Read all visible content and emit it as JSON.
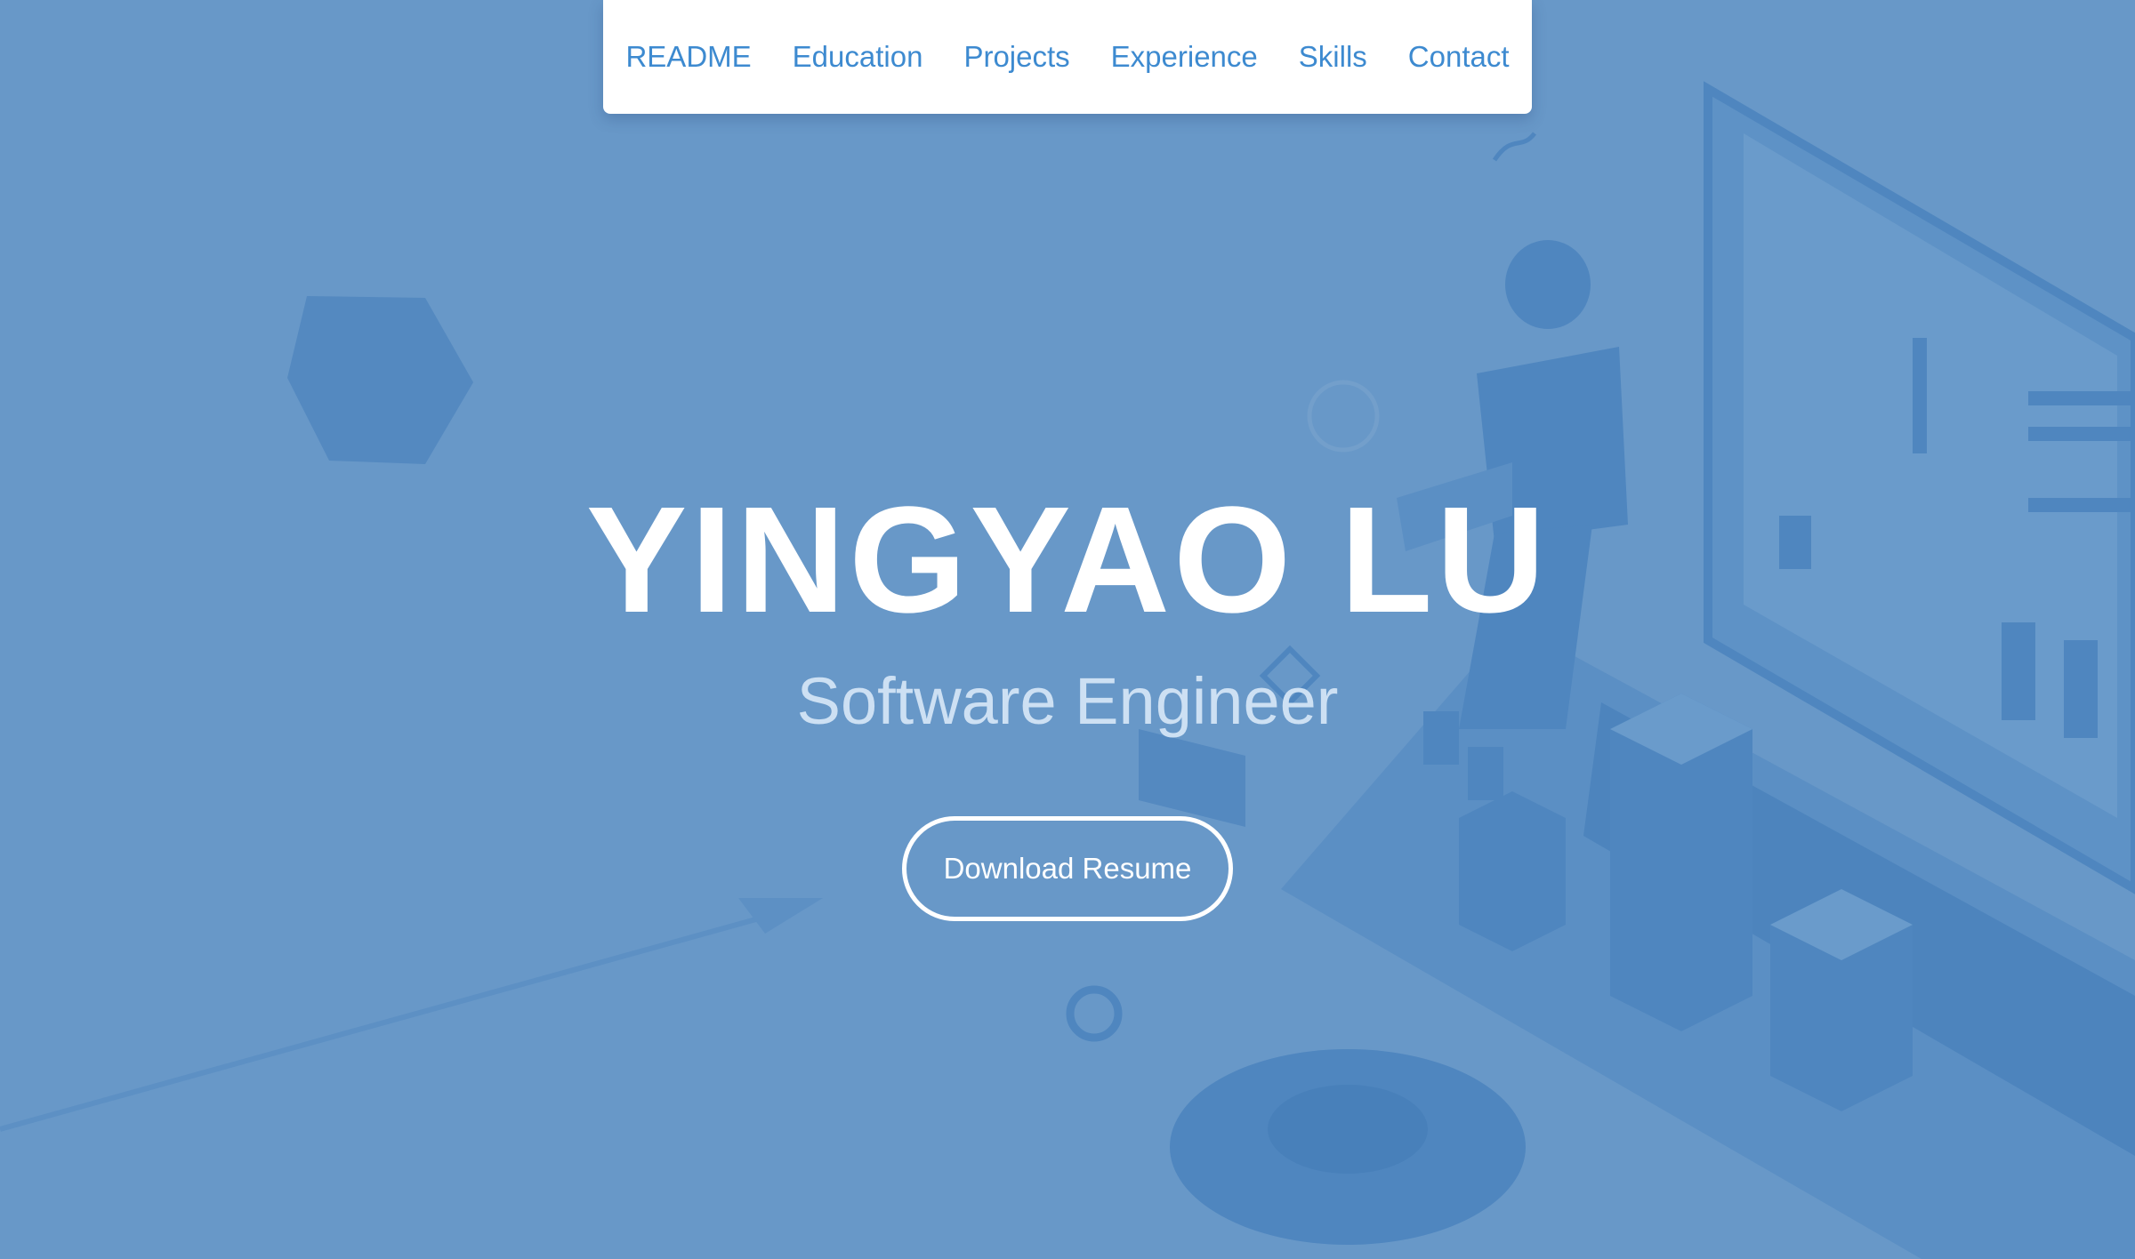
{
  "nav": {
    "items": [
      {
        "label": "README"
      },
      {
        "label": "Education"
      },
      {
        "label": "Projects"
      },
      {
        "label": "Experience"
      },
      {
        "label": "Skills"
      },
      {
        "label": "Contact"
      }
    ]
  },
  "hero": {
    "name": "YINGYAO LU",
    "title": "Software Engineer",
    "cta_label": "Download Resume"
  },
  "colors": {
    "background": "#6898c8",
    "accent": "#3d8ad0",
    "illustration": "#4f86bf"
  }
}
